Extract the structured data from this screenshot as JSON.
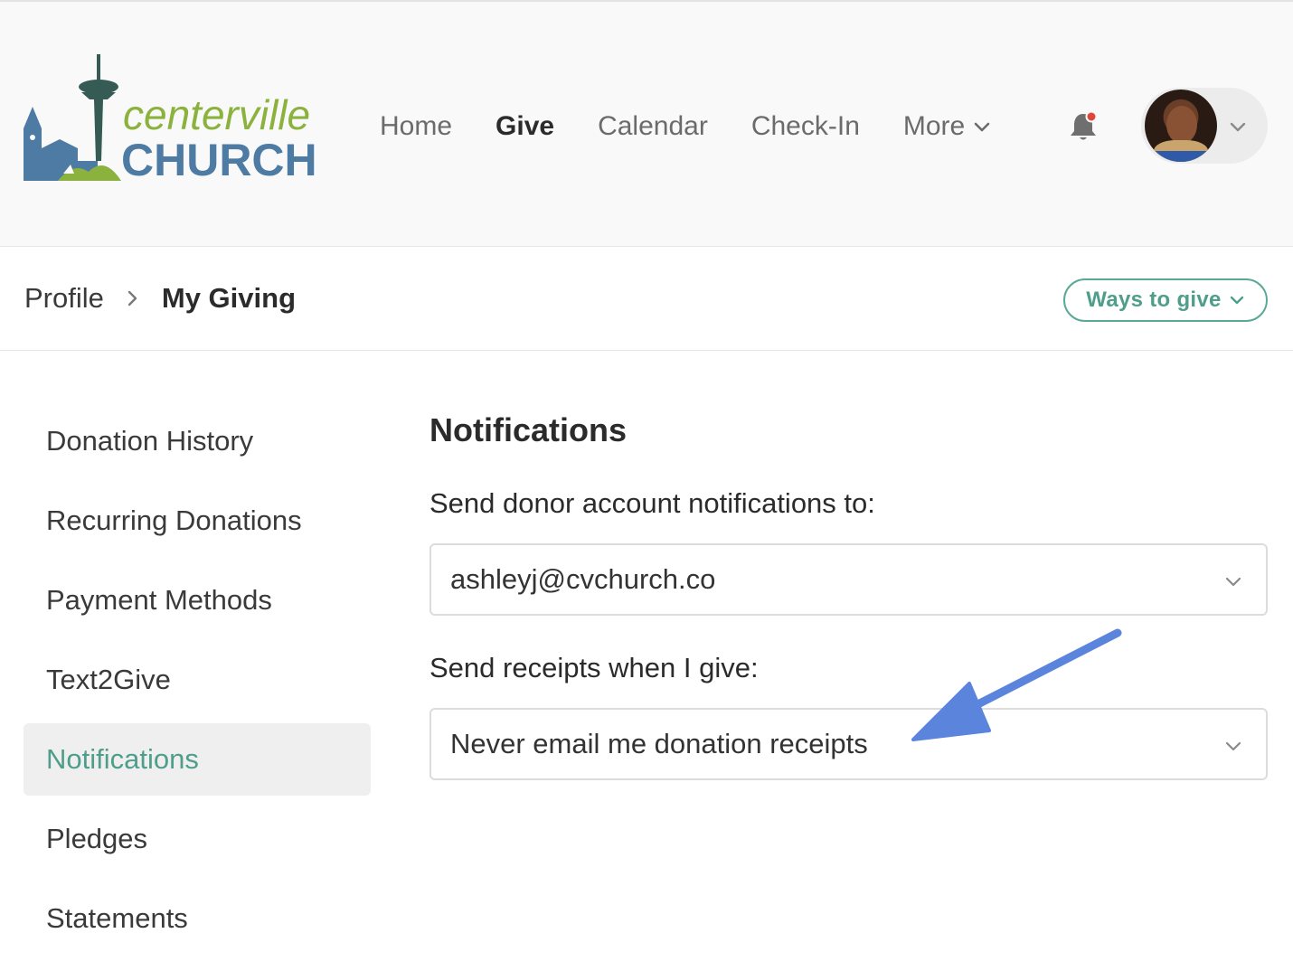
{
  "header": {
    "logo": {
      "word_1": "centerville",
      "word_2": "CHURCH"
    },
    "nav": [
      {
        "label": "Home",
        "active": false
      },
      {
        "label": "Give",
        "active": true
      },
      {
        "label": "Calendar",
        "active": false
      },
      {
        "label": "Check-In",
        "active": false
      },
      {
        "label": "More",
        "active": false,
        "has_dropdown": true
      }
    ],
    "notifications_icon": "bell-icon",
    "has_unread_notification": true,
    "user_menu_icon": "chevron-down-icon"
  },
  "breadcrumb": {
    "parent": "Profile",
    "current": "My Giving",
    "separator_icon": "chevron-right-icon"
  },
  "ways_to_give": {
    "label": "Ways to give",
    "icon": "chevron-down-icon"
  },
  "sidebar": {
    "items": [
      {
        "label": "Donation History",
        "active": false
      },
      {
        "label": "Recurring Donations",
        "active": false
      },
      {
        "label": "Payment Methods",
        "active": false
      },
      {
        "label": "Text2Give",
        "active": false
      },
      {
        "label": "Notifications",
        "active": true
      },
      {
        "label": "Pledges",
        "active": false
      },
      {
        "label": "Statements",
        "active": false
      }
    ]
  },
  "main": {
    "title": "Notifications",
    "notify_to": {
      "label": "Send donor account notifications to:",
      "value": "ashleyj@cvchurch.co"
    },
    "receipts": {
      "label": "Send receipts when I give:",
      "value": "Never email me donation receipts"
    }
  },
  "colors": {
    "accent": "#4e9e8b",
    "logo_green": "#8cb23e",
    "logo_blue": "#4e7ba3",
    "annotation_arrow": "#5b84dc",
    "notification_dot": "#e0463a"
  }
}
